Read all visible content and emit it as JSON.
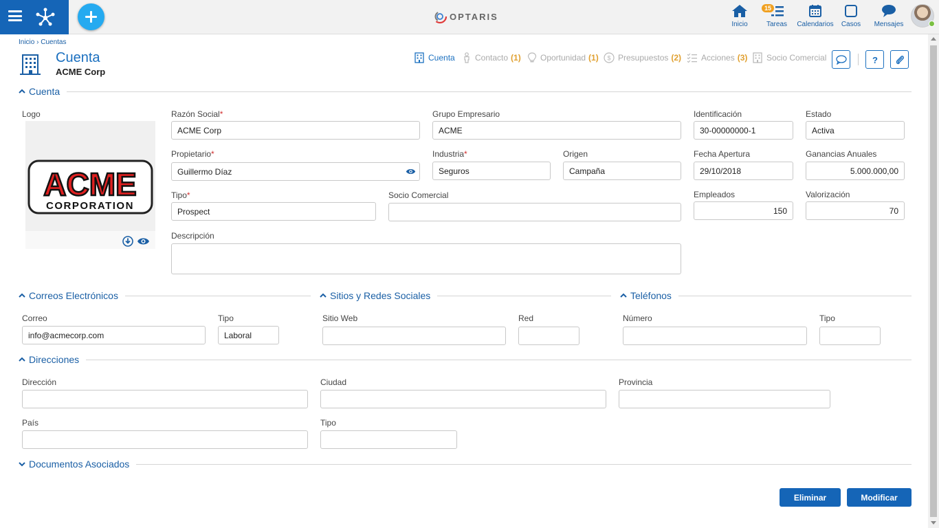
{
  "topbar": {
    "logo_text": "OPTARIS",
    "nav": [
      {
        "label": "Inicio",
        "icon": "home-icon"
      },
      {
        "label": "Tareas",
        "icon": "tasks-icon",
        "badge": "15"
      },
      {
        "label": "Calendarios",
        "icon": "calendar-icon"
      },
      {
        "label": "Casos",
        "icon": "case-icon"
      },
      {
        "label": "Mensajes",
        "icon": "message-icon"
      }
    ],
    "brand_color": "#1565b7",
    "add_color": "#25aaf0"
  },
  "breadcrumb": "Inicio › Cuentas",
  "header": {
    "title": "Cuenta",
    "subtitle": "ACME Corp",
    "tabs": [
      {
        "label": "Cuenta",
        "count": ""
      },
      {
        "label": "Contacto",
        "count": "(1)"
      },
      {
        "label": "Oportunidad",
        "count": "(1)"
      },
      {
        "label": "Presupuestos",
        "count": "(2)"
      },
      {
        "label": "Acciones",
        "count": "(3)"
      },
      {
        "label": "Socio Comercial",
        "count": ""
      }
    ]
  },
  "cuenta": {
    "section_title": "Cuenta",
    "logo_label": "Logo",
    "logo_text_top": "ACME",
    "logo_text_bottom": "CORPORATION",
    "fields": {
      "razon_social": {
        "label": "Razón Social",
        "req": "*",
        "value": "ACME Corp"
      },
      "grupo_empresario": {
        "label": "Grupo Empresario",
        "value": "ACME"
      },
      "identificacion": {
        "label": "Identificación",
        "value": "30-00000000-1"
      },
      "estado": {
        "label": "Estado",
        "value": "Activa"
      },
      "propietario": {
        "label": "Propietario",
        "req": "*",
        "value": "Guillermo Díaz"
      },
      "industria": {
        "label": "Industria",
        "req": "*",
        "value": "Seguros"
      },
      "origen": {
        "label": "Origen",
        "value": "Campaña"
      },
      "fecha_apertura": {
        "label": "Fecha Apertura",
        "value": "29/10/2018"
      },
      "ganancias": {
        "label": "Ganancias Anuales",
        "value": "5.000.000,00"
      },
      "tipo": {
        "label": "Tipo",
        "req": "*",
        "value": "Prospect"
      },
      "socio": {
        "label": "Socio Comercial",
        "value": ""
      },
      "empleados": {
        "label": "Empleados",
        "value": "150"
      },
      "valorizacion": {
        "label": "Valorización",
        "value": "70"
      },
      "descripcion": {
        "label": "Descripción",
        "value": ""
      }
    }
  },
  "correos": {
    "section_title": "Correos Electrónicos",
    "correo_label": "Correo",
    "correo_value": "info@acmecorp.com",
    "tipo_label": "Tipo",
    "tipo_value": "Laboral"
  },
  "sitios": {
    "section_title": "Sitios y Redes Sociales",
    "sitio_label": "Sitio Web",
    "sitio_value": "",
    "red_label": "Red",
    "red_value": ""
  },
  "telefonos": {
    "section_title": "Teléfonos",
    "numero_label": "Número",
    "numero_value": "",
    "tipo_label": "Tipo",
    "tipo_value": ""
  },
  "direcciones": {
    "section_title": "Direcciones",
    "direccion_label": "Dirección",
    "direccion_value": "",
    "ciudad_label": "Ciudad",
    "ciudad_value": "",
    "provincia_label": "Provincia",
    "provincia_value": "",
    "pais_label": "País",
    "pais_value": "",
    "tipo_label": "Tipo",
    "tipo_value": ""
  },
  "documentos": {
    "section_title": "Documentos Asociados"
  },
  "actions": {
    "delete_label": "Eliminar",
    "modify_label": "Modificar"
  }
}
